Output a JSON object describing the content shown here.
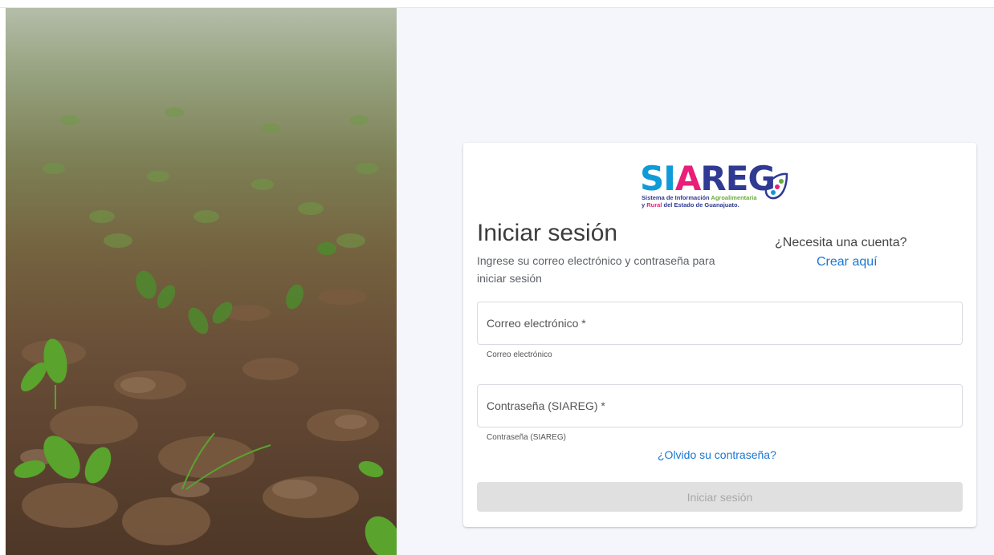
{
  "hero": {
    "icon": "field-seedlings-photo"
  },
  "logo": {
    "letters": [
      "SI",
      "A",
      "REG"
    ],
    "tag_line1_a": "Sistema de Información ",
    "tag_line1_b": "Agroalimentaria",
    "tag_line2_a": "y ",
    "tag_line2_b": "Rural",
    "tag_line2_c": " del Estado de Guanajuato.",
    "colors": {
      "blue": "#0f9bd7",
      "pink": "#e91e78",
      "navy": "#2f3a93",
      "green": "#6aab3a"
    }
  },
  "login": {
    "title": "Iniciar sesión",
    "subtitle": "Ingrese su correo electrónico y contraseña para iniciar sesión",
    "need_account": "¿Necesita una cuenta?",
    "create_link": "Crear aquí",
    "email_placeholder": "Correo electrónico *",
    "email_helper": "Correo electrónico",
    "password_placeholder": "Contraseña (SIAREG) *",
    "password_helper": "Contraseña (SIAREG)",
    "forgot_link": "¿Olvido su contraseña?",
    "submit_label": "Iniciar sesión"
  },
  "colors": {
    "link": "#1976d2",
    "disabled_button": "#e0e0e0",
    "background": "#f5f6fb"
  }
}
